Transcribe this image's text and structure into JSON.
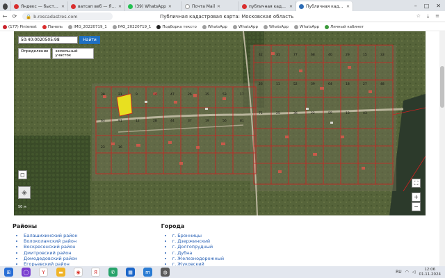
{
  "browser": {
    "tabs": [
      {
        "label": "Яндекс — быстрий п",
        "color": "#d92e2e"
      },
      {
        "label": "ватсап веб — Яндекс",
        "color": "#d92e2e"
      },
      {
        "label": "(39) WhatsApp",
        "color": "#25c052"
      },
      {
        "label": "Почта Mail",
        "color": "#ffffff"
      },
      {
        "label": "публичная кадастро",
        "color": "#d92e2e"
      },
      {
        "label": "Публичная кадастро",
        "color": "#2f6db5",
        "active": true
      }
    ],
    "url": "b.roscadastres.com",
    "page_title": "Публичная кадастровая карта: Московская область",
    "bookmarks": [
      {
        "label": "(177) Pinterest",
        "color": "#c8232c"
      },
      {
        "label": "Панель",
        "color": "#d92e2e"
      },
      {
        "label": "IMG_20220719_1",
        "color": "#9e9e9e"
      },
      {
        "label": "IMG_20220719_1",
        "color": "#9e9e9e"
      },
      {
        "label": "Подборка тексто",
        "color": "#222222"
      },
      {
        "label": "WhatsApp",
        "color": "#9e9e9e"
      },
      {
        "label": "WhatsApp",
        "color": "#9e9e9e"
      },
      {
        "label": "WhatsApp",
        "color": "#9e9e9e"
      },
      {
        "label": "WhatsApp",
        "color": "#9e9e9e"
      },
      {
        "label": "Личный кабинет",
        "color": "#3c9a3c"
      }
    ]
  },
  "map": {
    "search_value": "50:40:0020505:98",
    "find_label": "Найти",
    "definition_label": "Определение",
    "definition_value": "земельный участок",
    "scale_text": "50 м",
    "plot_labels": [
      "38",
      "21",
      "9",
      "14",
      "47",
      "26",
      "35",
      "53",
      "17",
      "63",
      "91",
      "12",
      "28",
      "44",
      "37",
      "19",
      "56",
      "81",
      "23",
      "16",
      "42",
      "31",
      "77",
      "68",
      "40",
      "29",
      "15",
      "33",
      "26",
      "11",
      "52",
      "39",
      "64",
      "18",
      "27",
      "48",
      "71",
      "25",
      "36",
      "22",
      "59",
      "13",
      "43"
    ]
  },
  "regions": {
    "heading": "Районы",
    "items": [
      "Балашихинский район",
      "Волоколамский район",
      "Воскресенский район",
      "Дмитровский район",
      "Домодедовский район",
      "Егорьевский район"
    ]
  },
  "cities": {
    "heading": "Города",
    "items": [
      "г. Бронницы",
      "г. Дзержинский",
      "г. Долгопрудный",
      "г. Дубна",
      "г. Железнодорожный",
      "г. Жуковский"
    ]
  },
  "taskbar": {
    "lang": "RU",
    "time": "12:06",
    "date": "01.11.2024"
  }
}
